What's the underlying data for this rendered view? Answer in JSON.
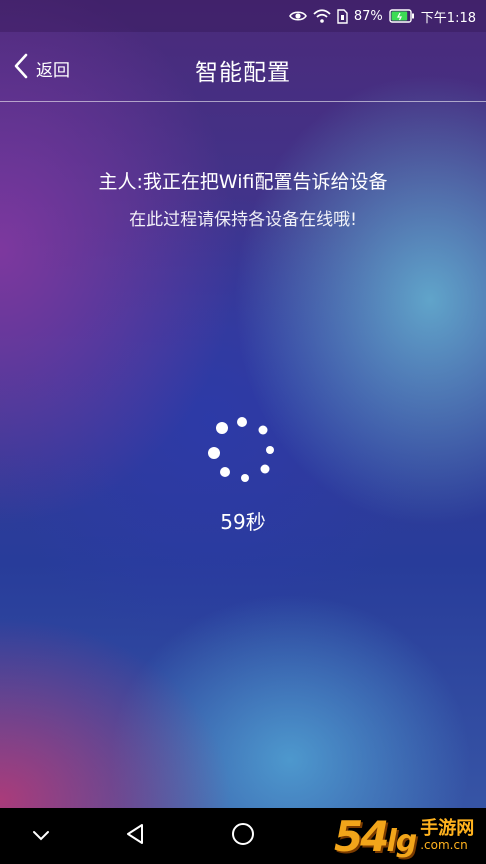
{
  "status_bar": {
    "battery_percent": "87%",
    "time": "下午1:18",
    "battery_level": 0.87,
    "icons": [
      "eye-icon",
      "wifi-icon",
      "sim-icon",
      "battery-icon"
    ]
  },
  "header": {
    "back_label": "返回",
    "title": "智能配置"
  },
  "main": {
    "message_line1": "主人:我正在把Wifi配置告诉给设备",
    "message_line2": "在此过程请保持各设备在线哦!",
    "countdown": "59秒"
  },
  "nav_bar": {
    "buttons": [
      "chevron-down-icon",
      "back-triangle-icon",
      "home-circle-icon"
    ]
  },
  "watermark": {
    "number": "54",
    "number_suffix": "lg",
    "text_cn": "手游网",
    "text_domain": ".com.cn",
    "color": "#f2a51a"
  }
}
